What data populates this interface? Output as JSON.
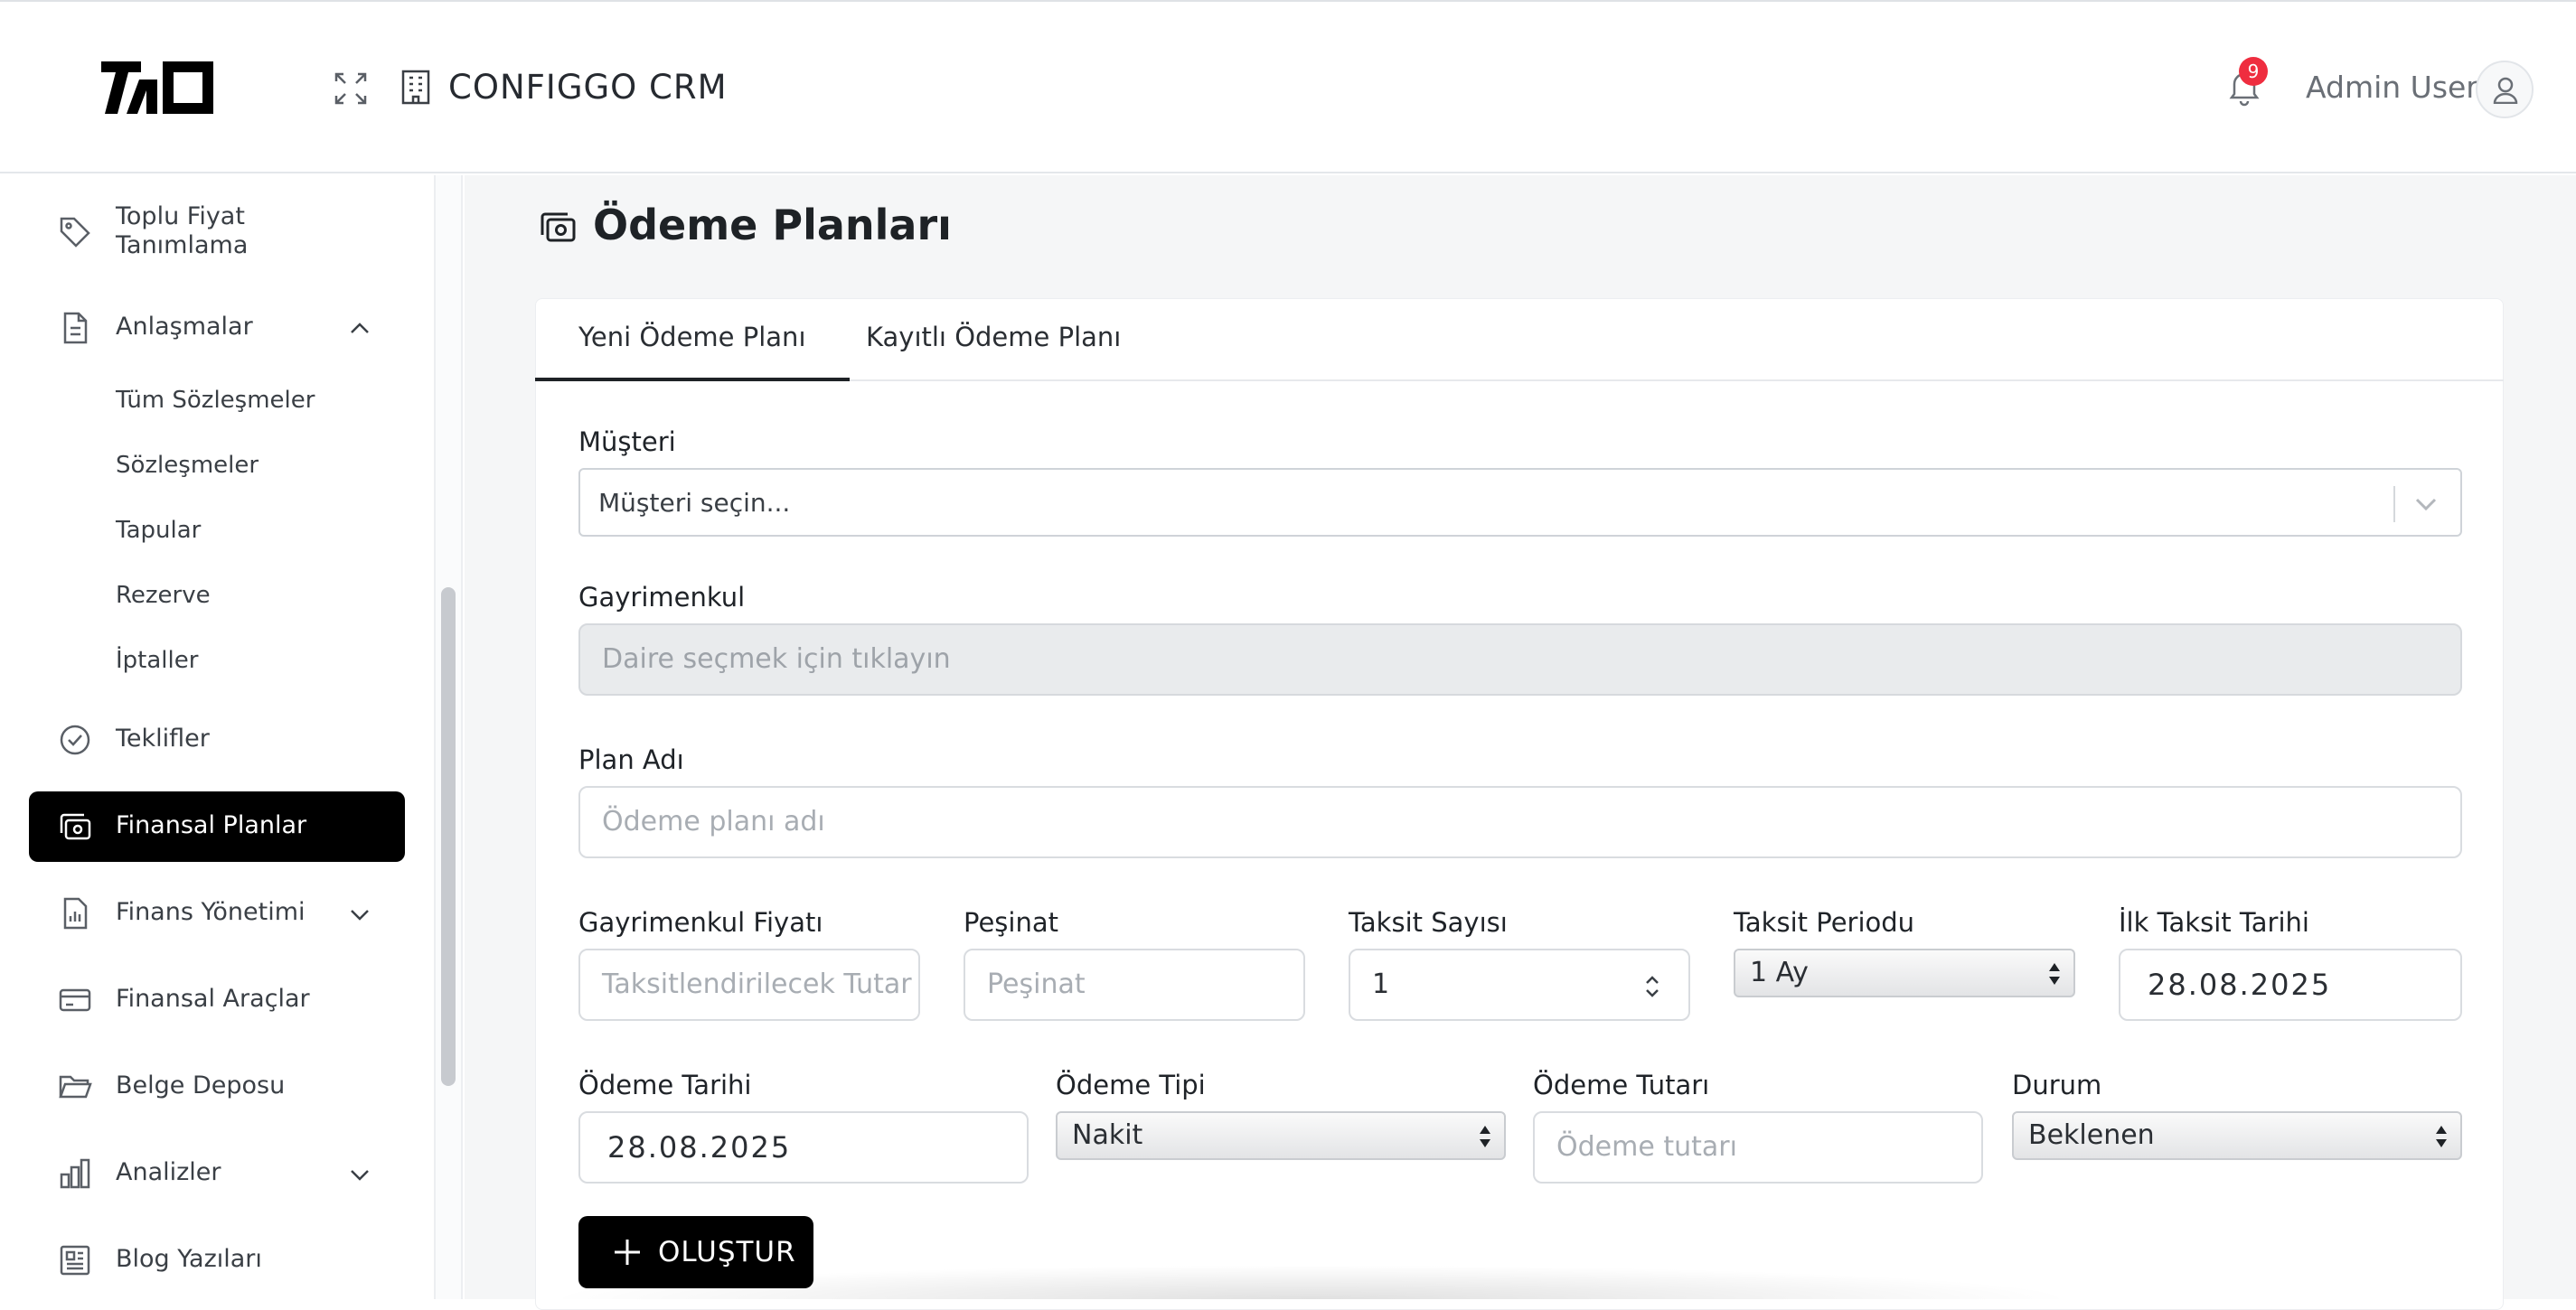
{
  "header": {
    "app_title": "CONFIGGO CRM",
    "notification_count": "9",
    "user_name": "Admin User"
  },
  "sidebar": {
    "items": [
      {
        "label": "Toplu Fiyat Tanımlama",
        "icon": "tag-icon"
      },
      {
        "label": "Anlaşmalar",
        "icon": "document-icon",
        "expanded": true
      },
      {
        "label": "Teklifler",
        "icon": "check-circle-icon"
      },
      {
        "label": "Finansal Planlar",
        "icon": "money-icon",
        "active": true
      },
      {
        "label": "Finans Yönetimi",
        "icon": "report-icon",
        "expanded": false
      },
      {
        "label": "Finansal Araçlar",
        "icon": "card-icon"
      },
      {
        "label": "Belge Deposu",
        "icon": "folder-icon"
      },
      {
        "label": "Analizler",
        "icon": "bar-chart-icon",
        "expanded": false
      },
      {
        "label": "Blog Yazıları",
        "icon": "newspaper-icon"
      }
    ],
    "sub_items": [
      "Tüm Sözleşmeler",
      "Sözleşmeler",
      "Tapular",
      "Rezerve",
      "İptaller"
    ]
  },
  "page": {
    "title": "Ödeme Planları",
    "tabs": [
      {
        "label": "Yeni Ödeme Planı",
        "active": true
      },
      {
        "label": "Kayıtlı Ödeme Planı",
        "active": false
      }
    ]
  },
  "form": {
    "customer": {
      "label": "Müşteri",
      "placeholder": "Müşteri seçin..."
    },
    "property": {
      "label": "Gayrimenkul",
      "placeholder": "Daire seçmek için tıklayın"
    },
    "plan_name": {
      "label": "Plan Adı",
      "placeholder": "Ödeme planı adı"
    },
    "property_price": {
      "label": "Gayrimenkul Fiyatı",
      "placeholder": "Taksitlendirilecek Tutar"
    },
    "down_payment": {
      "label": "Peşinat",
      "placeholder": "Peşinat"
    },
    "installment_count": {
      "label": "Taksit Sayısı",
      "value": "1"
    },
    "installment_period": {
      "label": "Taksit Periodu",
      "value": "1 Ay"
    },
    "first_installment_date": {
      "label": "İlk Taksit Tarihi",
      "value": "28.08.2025"
    },
    "payment_date": {
      "label": "Ödeme Tarihi",
      "value": "28.08.2025"
    },
    "payment_type": {
      "label": "Ödeme Tipi",
      "value": "Nakit"
    },
    "payment_amount": {
      "label": "Ödeme Tutarı",
      "placeholder": "Ödeme tutarı"
    },
    "status": {
      "label": "Durum",
      "value": "Beklenen"
    },
    "create_label": "OLUŞTUR"
  }
}
